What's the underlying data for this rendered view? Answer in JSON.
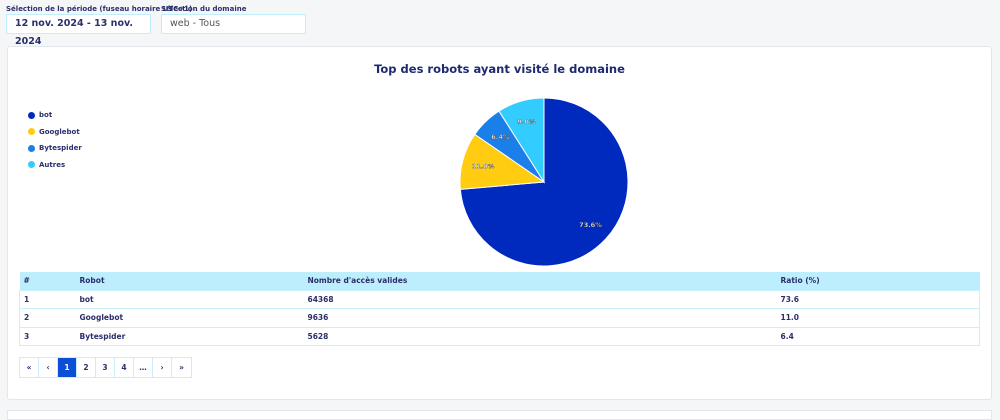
{
  "filters": {
    "period_label": "Sélection de la période (fuseau horaire UTC+1)",
    "period_value": "12 nov. 2024 - 13 nov. 2024",
    "domain_label": "Sélection du domaine",
    "domain_value": "web - Tous"
  },
  "chart_data": {
    "type": "pie",
    "title": "Top des robots ayant visité le domaine",
    "legend_position": "top-left",
    "slices": [
      {
        "label": "bot",
        "value": 73.6,
        "display": "73.6%",
        "color": "#0029be"
      },
      {
        "label": "Googlebot",
        "value": 11.0,
        "display": "11.0%",
        "color": "#ffcc11"
      },
      {
        "label": "Bytespider",
        "value": 6.4,
        "display": "6.4%",
        "color": "#1a7fe8"
      },
      {
        "label": "Autres",
        "value": 9.0,
        "display": "9.0%",
        "color": "#33ccff"
      }
    ]
  },
  "table": {
    "headers": [
      "#",
      "Robot",
      "Nombre d'accès valides",
      "Ratio (%)"
    ],
    "rows": [
      [
        "1",
        "bot",
        "64368",
        "73.6"
      ],
      [
        "2",
        "Googlebot",
        "9636",
        "11.0"
      ],
      [
        "3",
        "Bytespider",
        "5628",
        "6.4"
      ]
    ]
  },
  "pagination": [
    "«",
    "‹",
    "1",
    "2",
    "3",
    "4",
    "…",
    "›",
    "»"
  ],
  "pagination_active": "1"
}
